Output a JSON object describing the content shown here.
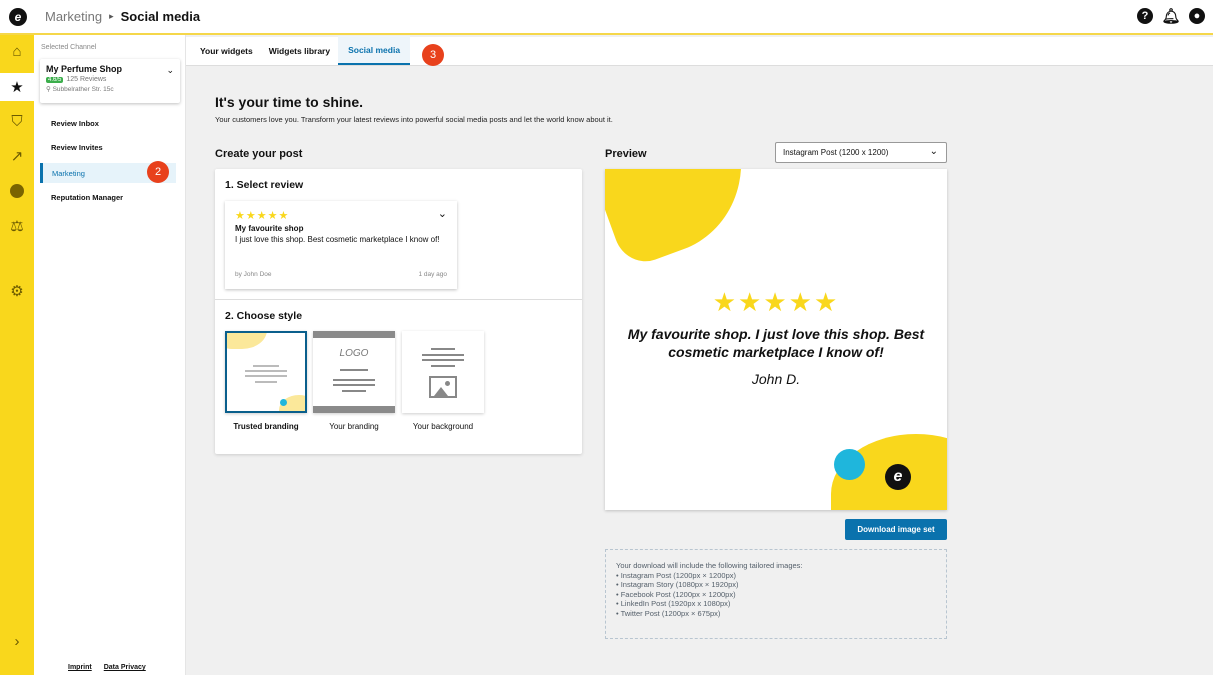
{
  "header": {
    "logo": "e",
    "breadcrumb_parent": "Marketing",
    "breadcrumb_separator": "▸",
    "breadcrumb_current": "Social media",
    "icons": [
      "help-icon",
      "bell-icon",
      "account-icon"
    ],
    "help_glyph": "?",
    "account_glyph": "●"
  },
  "rail": {
    "icons": [
      "home-icon",
      "star-icon",
      "shield-icon",
      "chart-icon",
      "e-icon",
      "scales-icon",
      "gear-icon",
      "expand-chevron-icon"
    ]
  },
  "sidebar": {
    "selected_channel_label": "Selected Channel",
    "channel": {
      "name": "My Perfume Shop",
      "score": "4.6/5",
      "reviews": "125 Reviews",
      "address": "Subbelrather Str. 15c"
    },
    "items": [
      {
        "label": "Review Inbox"
      },
      {
        "label": "Review Invites"
      },
      {
        "label": "Marketing"
      },
      {
        "label": "Reputation Manager"
      }
    ],
    "footer": {
      "imprint": "Imprint",
      "privacy": "Data Privacy"
    }
  },
  "annotations": {
    "marker_2": "2",
    "marker_3": "3"
  },
  "tabs": [
    {
      "label": "Your widgets"
    },
    {
      "label": "Widgets library"
    },
    {
      "label": "Social media"
    }
  ],
  "main": {
    "title": "It's your time to shine.",
    "intro": "Your customers love you. Transform your latest reviews into powerful social media posts and let the world know about it.",
    "create_heading": "Create your post",
    "step1": "1. Select review",
    "review": {
      "stars": "★★★★★",
      "title": "My favourite shop",
      "body": "I just love this shop. Best cosmetic marketplace I know of!",
      "author": "by John Doe",
      "age": "1 day ago"
    },
    "step2": "2. Choose style",
    "styles": [
      {
        "label": "Trusted branding"
      },
      {
        "label": "Your branding"
      },
      {
        "label": "Your background"
      }
    ],
    "logo_placeholder": "LOGO"
  },
  "preview": {
    "heading": "Preview",
    "format_select": "Instagram Post (1200 x 1200)",
    "stars": "★★★★★",
    "quote": "My favourite shop. I just love this shop. Best cosmetic marketplace I know of!",
    "author": "John D.",
    "download_button": "Download image set",
    "info_intro": "Your download will include the following tailored images:",
    "info_items": [
      "• Instagram Post (1200px × 1200px)",
      "• Instagram Story (1080px × 1920px)",
      "• Facebook Post (1200px × 1200px)",
      "• LinkedIn Post (1920px x 1080px)",
      "• Twitter Post (1200px × 675px)"
    ]
  },
  "colors": {
    "accent": "#0a72ad",
    "brand_yellow": "#f9d71c",
    "badge_red": "#e8411c",
    "cyan": "#1fb6dc"
  }
}
